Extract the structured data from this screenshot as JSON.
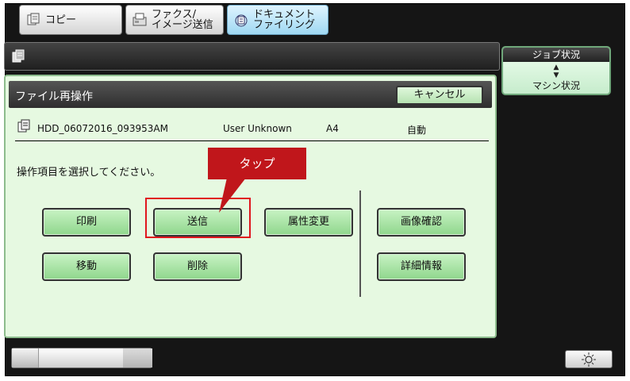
{
  "tabs": [
    {
      "label": "コピー",
      "active": false
    },
    {
      "label_line1": "ファクス/",
      "label_line2": "イメージ送信",
      "active": false
    },
    {
      "label_line1": "ドキュメント",
      "label_line2": "ファイリング",
      "active": true
    }
  ],
  "status_button": {
    "top_label": "ジョブ状況",
    "arrows": "▲\n▼",
    "bottom_label": "マシン状況"
  },
  "panel": {
    "title": "ファイル再操作",
    "cancel_label": "キャンセル",
    "file": {
      "name": "HDD_06072016_093953AM",
      "user": "User Unknown",
      "paper": "A4",
      "color_mode": "自動"
    },
    "instruction": "操作項目を選択してください。"
  },
  "operations": {
    "print": "印刷",
    "send": "送信",
    "change_property": "属性変更",
    "check_image": "画像確認",
    "move": "移動",
    "delete": "削除",
    "detail": "詳細情報"
  },
  "callout": {
    "label": "タップ",
    "color": "#c0161b",
    "highlight_color": "#e0161d"
  },
  "colors": {
    "panel_bg": "#e6f9e1",
    "button_green": "#8fd68c",
    "active_tab": "#9fd8f2"
  }
}
